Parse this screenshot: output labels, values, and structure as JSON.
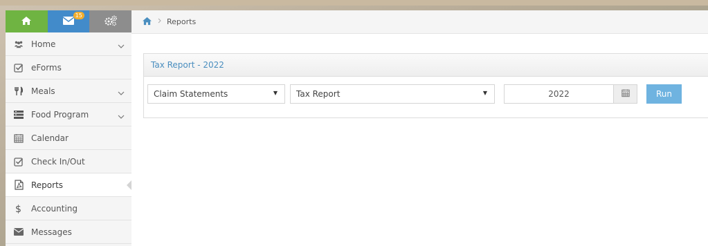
{
  "topbar": {
    "home_icon": "home-icon",
    "mail_icon": "envelope-icon",
    "mail_badge": "15",
    "settings_icon": "gears-icon"
  },
  "sidebar": {
    "items": [
      {
        "label": "Home",
        "icon": "users-icon",
        "chevron": true
      },
      {
        "label": "eForms",
        "icon": "check-square-icon",
        "chevron": false
      },
      {
        "label": "Meals",
        "icon": "cutlery-icon",
        "chevron": true
      },
      {
        "label": "Food Program",
        "icon": "list-icon",
        "chevron": true
      },
      {
        "label": "Calendar",
        "icon": "calendar-icon",
        "chevron": false
      },
      {
        "label": "Check In/Out",
        "icon": "check-square-icon",
        "chevron": false
      },
      {
        "label": "Reports",
        "icon": "pdf-file-icon",
        "chevron": false,
        "active": true
      },
      {
        "label": "Accounting",
        "icon": "dollar-icon",
        "chevron": false
      },
      {
        "label": "Messages",
        "icon": "envelope-icon",
        "chevron": false
      }
    ]
  },
  "breadcrumb": {
    "home_icon": "home-icon",
    "current": "Reports"
  },
  "widget": {
    "title": "Tax Report - 2022",
    "report_category_select": "Claim Statements",
    "report_type_select": "Tax Report",
    "year_value": "2022",
    "run_label": "Run"
  },
  "colors": {
    "green": "#6fb442",
    "blue": "#428bca",
    "gray": "#8d8d8d",
    "badge": "#f0ad2e",
    "title_blue": "#4a8ebf",
    "run_button": "#6fb3e0"
  }
}
